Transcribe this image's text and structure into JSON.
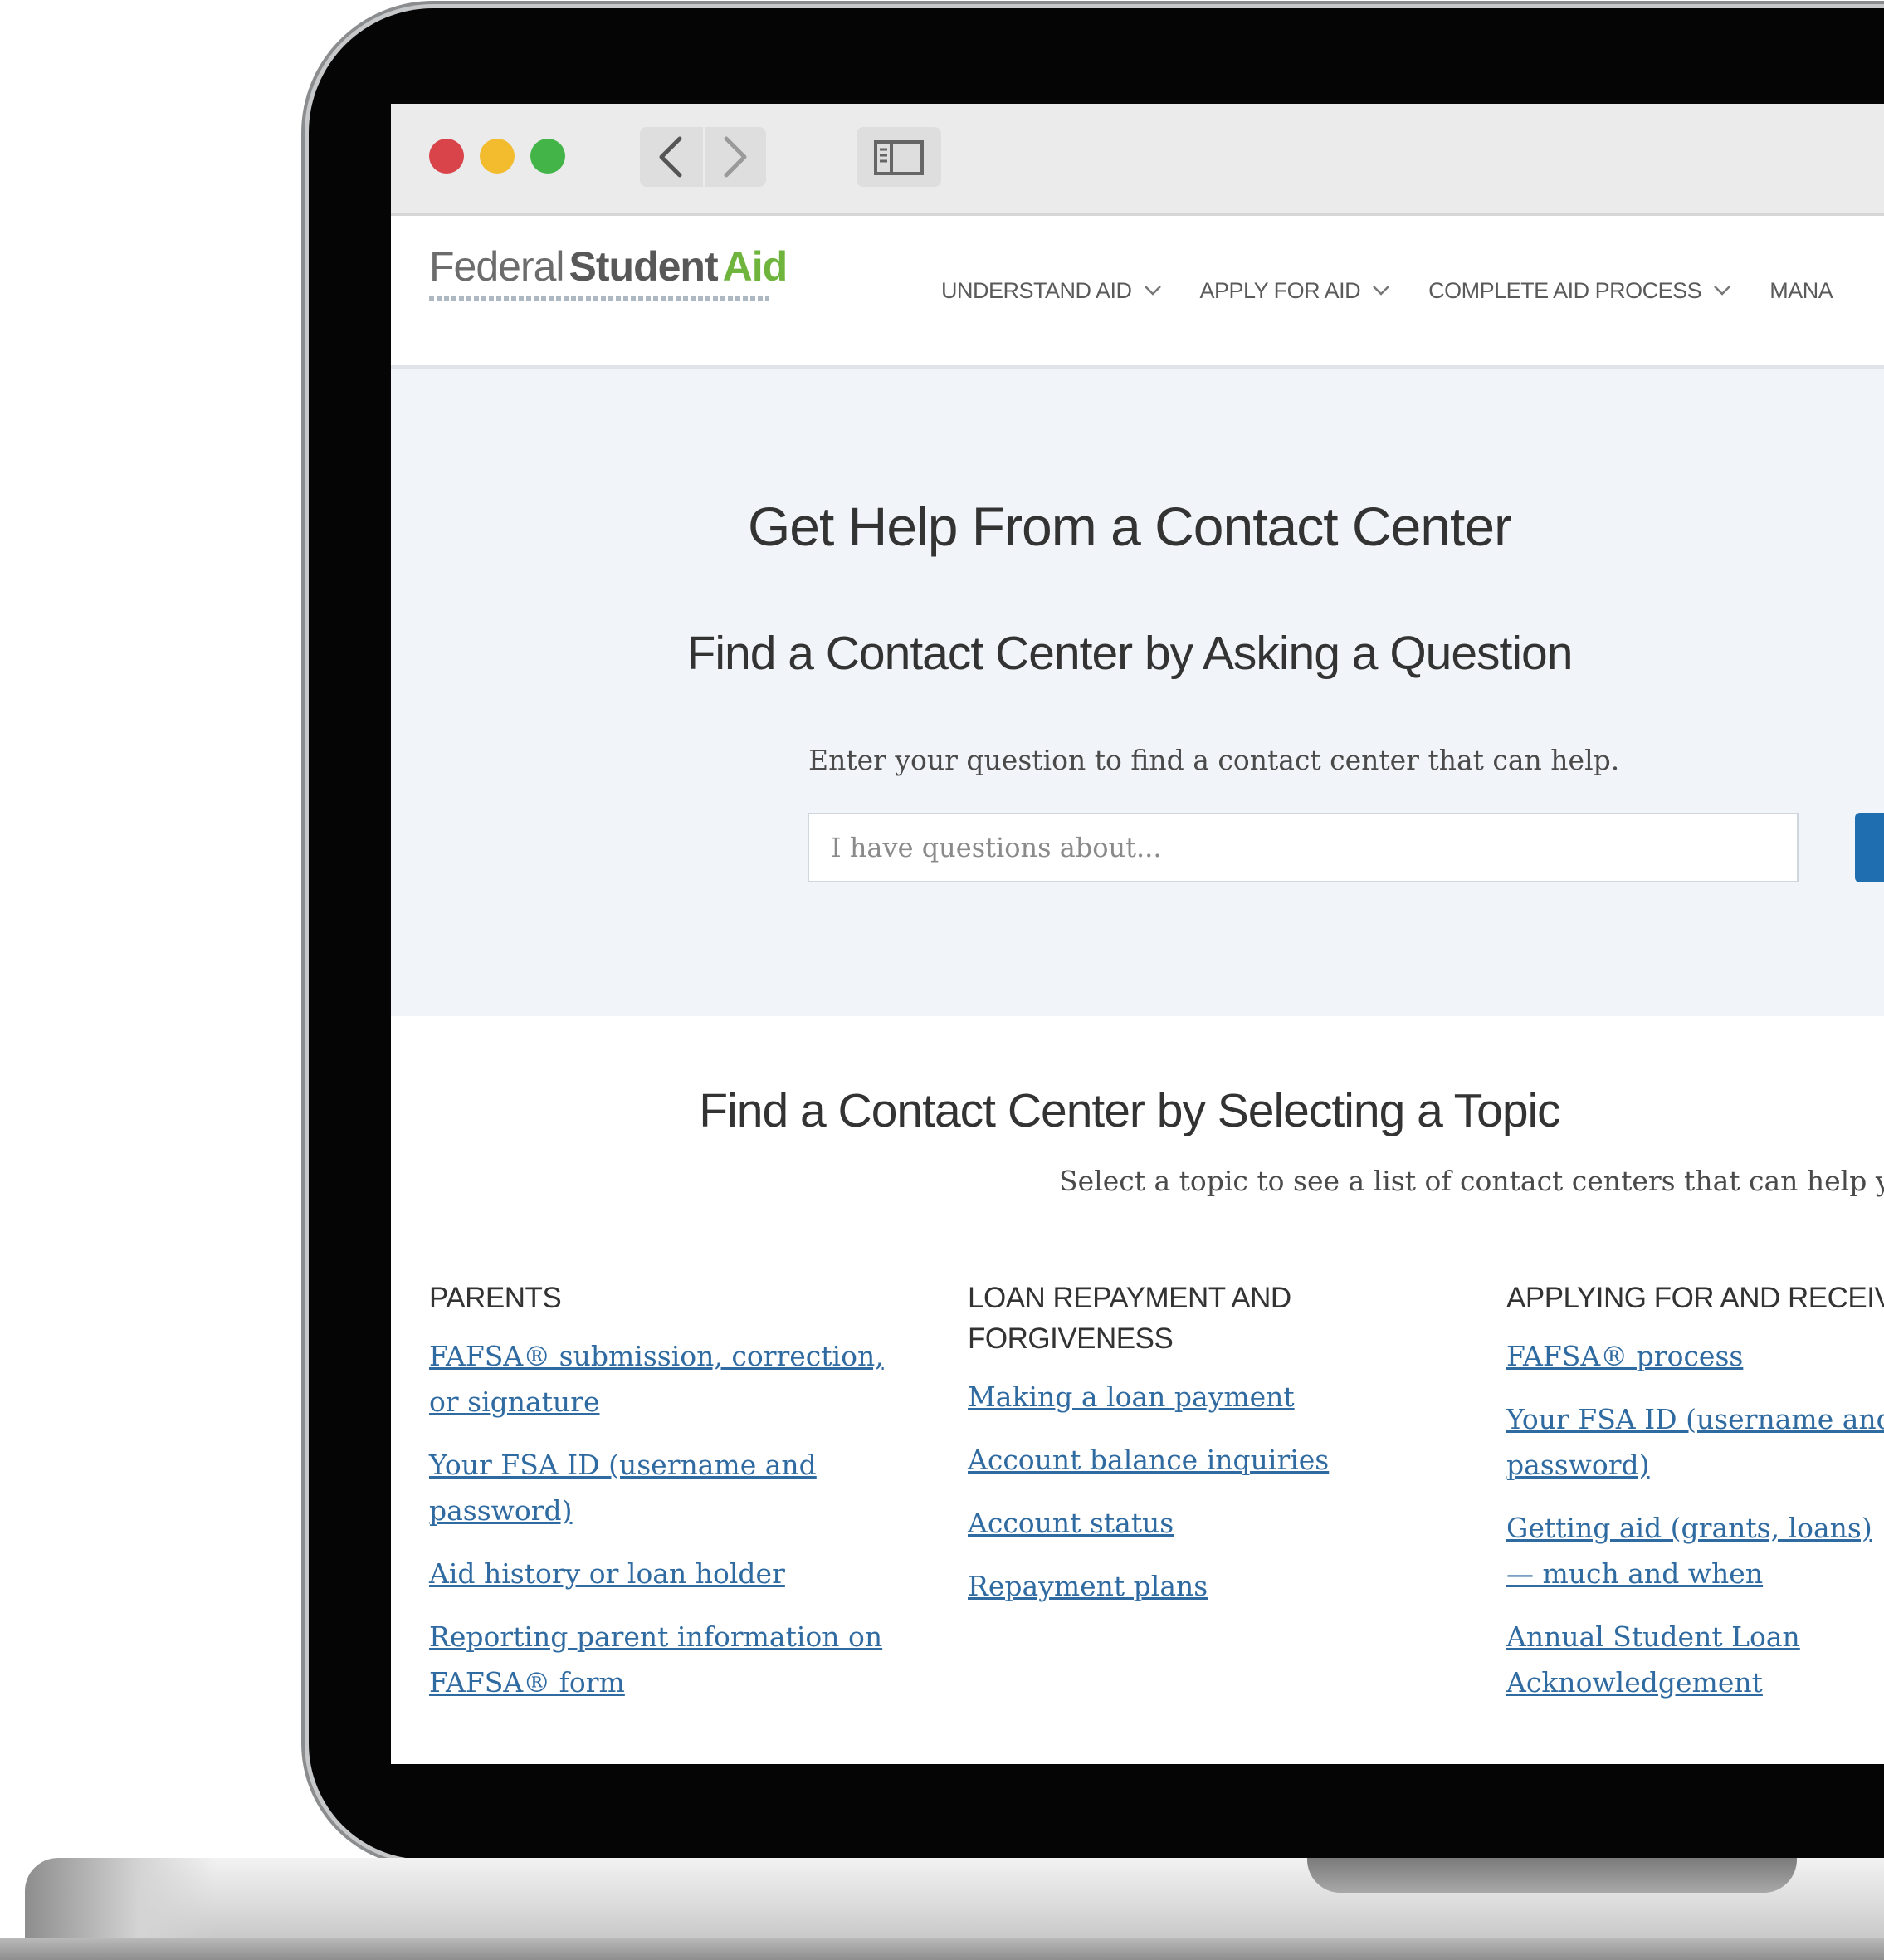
{
  "browser": {
    "sidebar_icon": "sidebar-icon",
    "back_icon": "chevron-left-icon",
    "forward_icon": "chevron-right-icon"
  },
  "site": {
    "logo": {
      "part1": "Federal",
      "part2": "Student",
      "part3": "Aid"
    },
    "nav": [
      {
        "label": "UNDERSTAND AID"
      },
      {
        "label": "APPLY FOR AID"
      },
      {
        "label": "COMPLETE AID PROCESS"
      },
      {
        "label": "MANA"
      }
    ]
  },
  "hero": {
    "title": "Get Help From a Contact Center",
    "subtitle": "Find a Contact Center by Asking a Question",
    "question_label": "Enter your question to find a contact center that can help.",
    "question_placeholder": "I have questions about..."
  },
  "topics": {
    "title": "Find a Contact Center by Selecting a Topic",
    "subtitle": "Select a topic to see a list of contact centers that can help you",
    "columns": [
      {
        "heading": "PARENTS",
        "links": [
          "FAFSA® submission, correction, or signature",
          "Your FSA ID (username and password)",
          "Aid history or loan holder",
          "Reporting parent information on FAFSA® form"
        ]
      },
      {
        "heading": "LOAN REPAYMENT AND FORGIVENESS",
        "links": [
          "Making a loan payment",
          "Account balance inquiries",
          "Account status",
          "Repayment plans"
        ]
      },
      {
        "heading": "APPLYING FOR AND RECEIVIN",
        "links": [
          "FAFSA® process",
          "Your FSA ID (username and password)",
          "Getting aid (grants, loans)— much and when",
          "Annual Student Loan Acknowledgement"
        ]
      }
    ]
  },
  "colors": {
    "accent_blue": "#1f6fb0",
    "link_blue": "#2f6aa0",
    "logo_green": "#6fb53d",
    "hero_bg": "#f1f5f9"
  }
}
